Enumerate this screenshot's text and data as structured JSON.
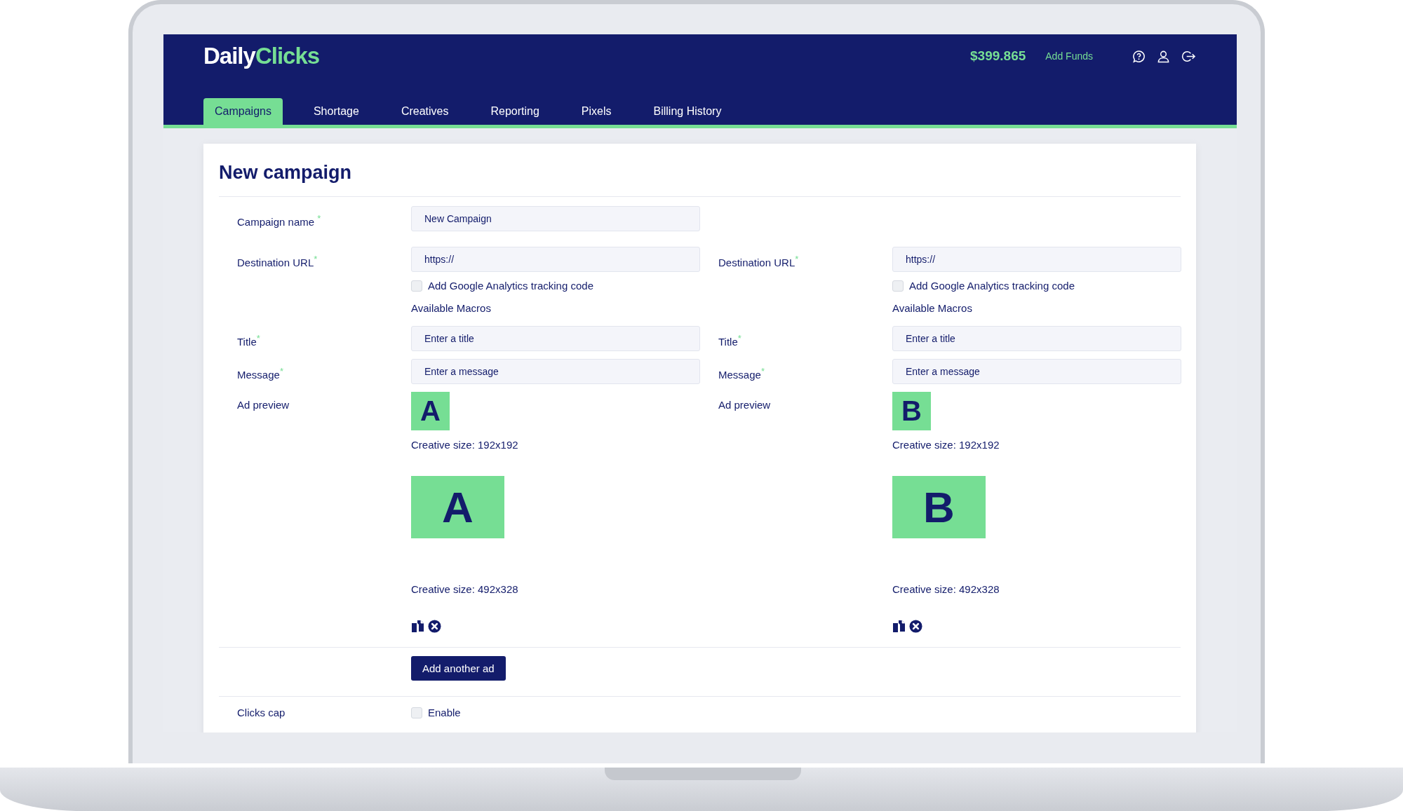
{
  "header": {
    "logo": {
      "first": "Daily",
      "second": "Clicks"
    },
    "balance": "$399.865",
    "add_funds": "Add Funds"
  },
  "tabs": [
    {
      "label": "Campaigns",
      "selected": true
    },
    {
      "label": "Shortage",
      "selected": false
    },
    {
      "label": "Creatives",
      "selected": false
    },
    {
      "label": "Reporting",
      "selected": false
    },
    {
      "label": "Pixels",
      "selected": false
    },
    {
      "label": "Billing History",
      "selected": false
    }
  ],
  "form": {
    "title": "New campaign",
    "campaign_name": {
      "label": "Campaign name",
      "mark": "*",
      "value": "New Campaign"
    },
    "ads": [
      {
        "destination": {
          "label": "Destination URL",
          "mark": "*",
          "value": "https://"
        },
        "analytics": {
          "label": "Add Google Analytics tracking code",
          "checked": false
        },
        "macros": "Available Macros",
        "title": {
          "label": "Title",
          "mark": "*",
          "placeholder": "Enter a title"
        },
        "message": {
          "label": "Message",
          "mark": "*",
          "placeholder": "Enter a message"
        },
        "preview_label": "Ad preview",
        "small_creative": {
          "letter": "A",
          "size": "Creative size: 192x192"
        },
        "large_creative": {
          "letter": "A",
          "size": "Creative size: 492x328"
        }
      },
      {
        "destination": {
          "label": "Destination URL",
          "mark": "*",
          "value": "https://"
        },
        "analytics": {
          "label": "Add Google Analytics tracking code",
          "checked": false
        },
        "macros": "Available Macros",
        "title": {
          "label": "Title",
          "mark": "*",
          "placeholder": "Enter a title"
        },
        "message": {
          "label": "Message",
          "mark": "*",
          "placeholder": "Enter a message"
        },
        "preview_label": "Ad preview",
        "small_creative": {
          "letter": "B",
          "size": "Creative size: 192x192"
        },
        "large_creative": {
          "letter": "B",
          "size": "Creative size: 492x328"
        }
      }
    ],
    "add_button": "Add another ad",
    "clicks_cap": {
      "label": "Clicks cap",
      "option": "Enable",
      "checked": false
    }
  }
}
